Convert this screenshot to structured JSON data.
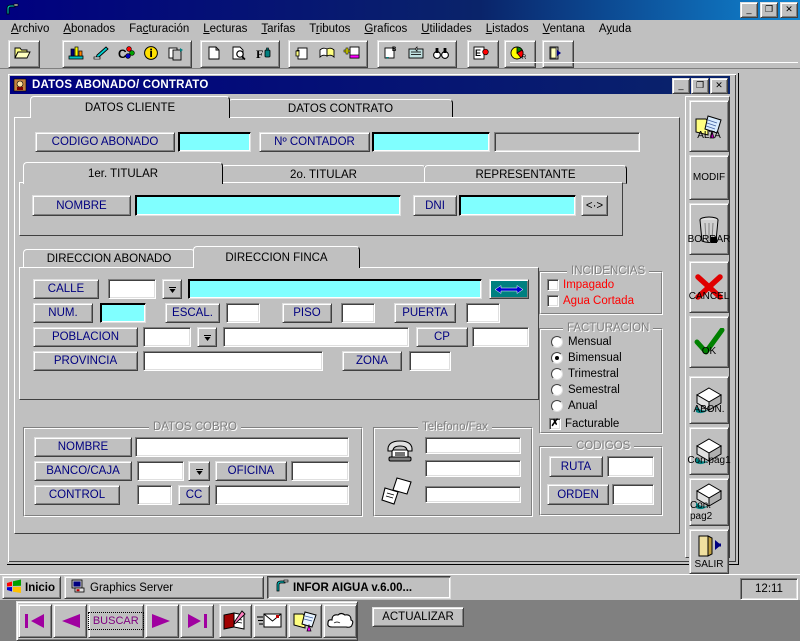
{
  "window": {
    "title": "",
    "minimize": "_",
    "maximize": "❐",
    "close": "✕"
  },
  "menubar": {
    "items": [
      {
        "pre": "",
        "accel": "A",
        "post": "rchivo"
      },
      {
        "pre": "",
        "accel": "A",
        "post": "bonados"
      },
      {
        "pre": "Fa",
        "accel": "c",
        "post": "turación"
      },
      {
        "pre": "",
        "accel": "L",
        "post": "ecturas"
      },
      {
        "pre": "",
        "accel": "T",
        "post": "arifas"
      },
      {
        "pre": "T",
        "accel": "r",
        "post": "ibutos"
      },
      {
        "pre": "",
        "accel": "G",
        "post": "raficos"
      },
      {
        "pre": "",
        "accel": "U",
        "post": "tilidades"
      },
      {
        "pre": "",
        "accel": "L",
        "post": "istados"
      },
      {
        "pre": "",
        "accel": "V",
        "post": "entana"
      },
      {
        "pre": "A",
        "accel": "y",
        "post": "uda"
      }
    ]
  },
  "toolbar": {
    "groups": [
      {
        "buttons": [
          {
            "icon": "open-folder-icon"
          }
        ]
      },
      {
        "buttons": [
          {
            "icon": "chart-bar-icon"
          },
          {
            "icon": "brush-icon"
          },
          {
            "icon": "color-palette-icon"
          },
          {
            "icon": "info-icon"
          },
          {
            "icon": "copy-records-icon"
          }
        ]
      },
      {
        "buttons": [
          {
            "icon": "new-document-icon"
          },
          {
            "icon": "preview-icon"
          },
          {
            "icon": "font-icon"
          }
        ]
      },
      {
        "buttons": [
          {
            "icon": "print-secure-icon"
          },
          {
            "icon": "book-icon"
          },
          {
            "icon": "add-record-icon"
          }
        ]
      },
      {
        "buttons": [
          {
            "icon": "report-b-icon"
          },
          {
            "icon": "form-icon"
          },
          {
            "icon": "binoculars-icon"
          }
        ]
      },
      {
        "buttons": [
          {
            "icon": "export-icon"
          }
        ]
      },
      {
        "buttons": [
          {
            "icon": "pie-chart-icon"
          }
        ]
      },
      {
        "buttons": [
          {
            "icon": "exit-door-icon"
          }
        ]
      }
    ]
  },
  "mdi": {
    "title": "DATOS ABONADO/ CONTRATO",
    "icon": "tap-water-icon",
    "minimize": "_",
    "restore": "❐",
    "close": "✕"
  },
  "main_tabs": [
    {
      "label": "DATOS CLIENTE",
      "selected": true
    },
    {
      "label": "DATOS CONTRATO",
      "selected": false
    }
  ],
  "header_row": {
    "codigo_abonado": {
      "label": "CODIGO ABONADO",
      "value": ""
    },
    "n_contador": {
      "label": "Nº CONTADOR",
      "value": ""
    },
    "extra_field": {
      "value": ""
    }
  },
  "titular_tabs": [
    {
      "label": "1er. TITULAR",
      "selected": true
    },
    {
      "label": "2o. TITULAR",
      "selected": false
    },
    {
      "label": "REPRESENTANTE",
      "selected": false
    }
  ],
  "titular": {
    "nombre": {
      "label": "NOMBRE",
      "value": ""
    },
    "dni": {
      "label": "DNI",
      "value": ""
    },
    "swap_button": {
      "icon": "left-right-small-icon",
      "label": "<·>"
    }
  },
  "direccion_tabs": [
    {
      "label": "DIRECCION ABONADO",
      "selected": false
    },
    {
      "label": "DIRECCION FINCA",
      "selected": true
    }
  ],
  "direccion": {
    "calle": {
      "label": "CALLE",
      "code": "",
      "name": ""
    },
    "calle_dropdown": {
      "icon": "dropdown-arrow-icon"
    },
    "calle_swap": {
      "icon": "double-arrow-icon"
    },
    "num": {
      "label": "NUM.",
      "value": ""
    },
    "escal": {
      "label": "ESCAL.",
      "value": ""
    },
    "piso": {
      "label": "PISO",
      "value": ""
    },
    "puerta": {
      "label": "PUERTA",
      "value": ""
    },
    "poblacion": {
      "label": "POBLACION",
      "code": "",
      "name": ""
    },
    "poblacion_dropdown": {
      "icon": "dropdown-arrow-icon"
    },
    "cp": {
      "label": "CP",
      "value": ""
    },
    "provincia": {
      "label": "PROVINCIA",
      "value": ""
    },
    "zona": {
      "label": "ZONA",
      "value": ""
    }
  },
  "incidencias": {
    "caption": "INCIDENCIAS",
    "color": "#ff0000",
    "items": [
      {
        "label": "Impagado",
        "checked": false
      },
      {
        "label": "Agua Cortada",
        "checked": false
      }
    ]
  },
  "facturacion": {
    "caption": "FACTURACION",
    "options": [
      {
        "label": "Mensual",
        "selected": false
      },
      {
        "label": "Bimensual",
        "selected": true
      },
      {
        "label": "Trimestral",
        "selected": false
      },
      {
        "label": "Semestral",
        "selected": false
      },
      {
        "label": "Anual",
        "selected": false
      }
    ],
    "facturable": {
      "label": "Facturable",
      "checked": true,
      "mark": "✗"
    }
  },
  "datos_cobro": {
    "caption": "DATOS COBRO",
    "nombre": {
      "label": "NOMBRE",
      "value": ""
    },
    "banco_caja": {
      "label": "BANCO/CAJA",
      "value": ""
    },
    "banco_dropdown": {
      "icon": "dropdown-arrow-icon"
    },
    "oficina": {
      "label": "OFICINA",
      "value": ""
    },
    "control": {
      "label": "CONTROL",
      "value": ""
    },
    "cc": {
      "label": "CC",
      "value": ""
    }
  },
  "telefono_fax": {
    "caption": "Telefono/Fax",
    "phone_icon": "telephone-icon",
    "fax_icon": "fax-icon",
    "fields": [
      {
        "value": ""
      },
      {
        "value": ""
      },
      {
        "value": ""
      }
    ]
  },
  "codigos": {
    "caption": "CODIGOS",
    "ruta": {
      "label": "RUTA",
      "value": ""
    },
    "orden": {
      "label": "ORDEN",
      "value": ""
    }
  },
  "navbar": {
    "first": {
      "icon": "first-record-icon"
    },
    "prev": {
      "icon": "prev-record-icon"
    },
    "buscar": {
      "label": "BUSCAR",
      "focused": true
    },
    "next": {
      "icon": "next-record-icon"
    },
    "last": {
      "icon": "last-record-icon"
    },
    "tools": [
      {
        "icon": "notebook-pen-icon"
      },
      {
        "icon": "envelope-send-icon"
      },
      {
        "icon": "folder-edit-icon"
      },
      {
        "icon": "cloud-icon"
      }
    ],
    "actualizar": {
      "label": "ACTUALIZAR"
    }
  },
  "sidebar": {
    "buttons": [
      {
        "label": "ALTA",
        "icon": "new-folder-icon",
        "overlap": true
      },
      {
        "label": "MODIF",
        "icon": "",
        "overlap": false
      },
      {
        "label": "BORRAR",
        "icon": "trash-icon",
        "overlap": true
      },
      {
        "label": "CANCEL",
        "icon": "red-x-icon",
        "overlap": true
      },
      {
        "label": "OK",
        "icon": "green-check-icon",
        "overlap": true
      },
      {
        "label": "ABON.",
        "icon": "box-icon",
        "overlap": true
      },
      {
        "label": "Con.pag1",
        "icon": "box-icon",
        "overlap": true
      },
      {
        "label": "Con. pag2",
        "icon": "box-icon",
        "overlap": true
      },
      {
        "label": "SALIR",
        "icon": "exit-door-icon",
        "overlap": false
      }
    ]
  },
  "taskbar": {
    "start": {
      "label": "Inicio",
      "icon": "windows-logo-icon"
    },
    "tasks": [
      {
        "label": "Graphics Server",
        "icon": "graphics-server-icon",
        "active": false
      },
      {
        "label": "INFOR AIGUA v.6.00...",
        "icon": "tap-water-icon",
        "active": true
      }
    ],
    "clock": "12:11"
  }
}
